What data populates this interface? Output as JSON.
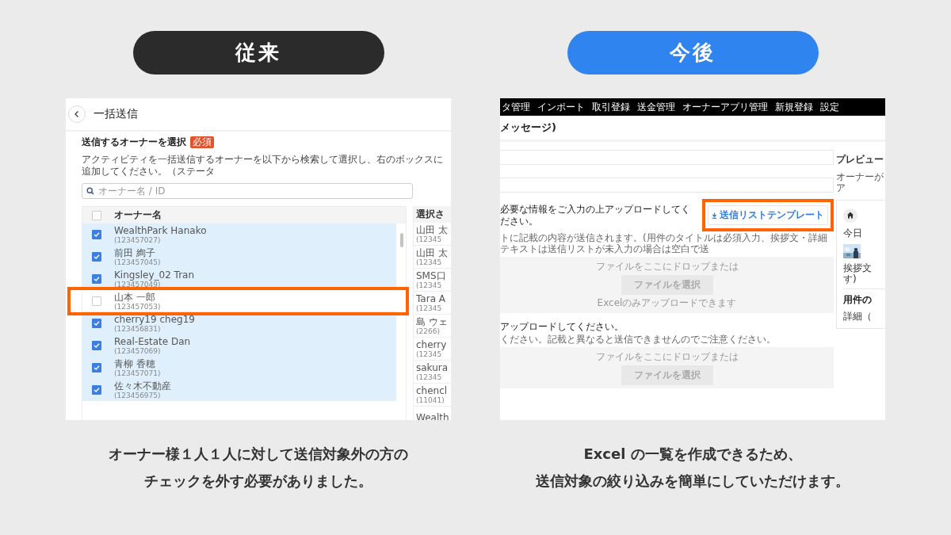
{
  "before": {
    "heading": "従来",
    "screen": {
      "page_title": "一括送信",
      "section_title": "送信するオーナーを選択",
      "required_badge": "必須",
      "description": "アクティビティを一括送信するオーナーを以下から検索して選択し、右のボックスに追加してください。（ステータ",
      "search": {
        "placeholder": "オーナー名 / ID"
      },
      "table": {
        "header_checkbox": {
          "checked": false
        },
        "column": "オーナー名",
        "rows": [
          {
            "name": "WealthPark Hanako",
            "id": "(123457027)",
            "checked": true,
            "highlighted": false
          },
          {
            "name": "前田 絢子",
            "id": "(123457045)",
            "checked": true,
            "highlighted": false
          },
          {
            "name": "Kingsley_02 Tran",
            "id": "(123457049)",
            "checked": true,
            "highlighted": false
          },
          {
            "name": "山本 一郎",
            "id": "(123457053)",
            "checked": false,
            "highlighted": true
          },
          {
            "name": "cherry19 cheg19",
            "id": "(123456831)",
            "checked": true,
            "highlighted": false
          },
          {
            "name": "Real-Estate Dan",
            "id": "(123457069)",
            "checked": true,
            "highlighted": false
          },
          {
            "name": "青柳 香穂",
            "id": "(123457071)",
            "checked": true,
            "highlighted": false
          },
          {
            "name": "佐々木不動産",
            "id": "(123456975)",
            "checked": true,
            "highlighted": false
          }
        ]
      },
      "selected_panel": {
        "header": "選択さ",
        "items": [
          {
            "name": "山田 太",
            "id": "(12345"
          },
          {
            "name": "山田 太",
            "id": "(12345"
          },
          {
            "name": "SMS口",
            "id": "(12345"
          },
          {
            "name": "Tara A",
            "id": "(12345"
          },
          {
            "name": "島 ウェ",
            "id": "(2266)"
          },
          {
            "name": "cherry",
            "id": "(12345"
          },
          {
            "name": "sakura",
            "id": "(12345"
          },
          {
            "name": "chencl",
            "id": "(11041)"
          },
          {
            "name": "Wealth"
          }
        ]
      }
    },
    "caption": [
      "オーナー様１人１人に対して送信対象外の方の",
      "チェックを外す必要がありました。"
    ]
  },
  "after": {
    "heading": "今後",
    "screen": {
      "nav": [
        "タ管理",
        "インポート",
        "取引登録",
        "送金管理",
        "オーナーアプリ管理",
        "新規登録",
        "設定"
      ],
      "page_title": "メッセージ)",
      "upload_sections": [
        {
          "heading": "必要な情報をご入力の上アップロードしてください。",
          "hint": "トに記載の内容が送信されます。(用件のタイトルは必須入力、挨拶文・詳細テキストは送信リストが未入力の場合は空白で送",
          "template_button": {
            "label": "送信リストテンプレート",
            "highlighted": true
          },
          "dropzone": {
            "prompt": "ファイルをここにドロップまたは",
            "button": "ファイルを選択",
            "note": "Excelのみアップロードできます"
          }
        },
        {
          "heading": "アップロードしてください。",
          "hint": "ください。記載と異なると送信できませんのでご注意ください。",
          "dropzone": {
            "prompt": "ファイルをここにドロップまたは",
            "button": "ファイルを選択"
          }
        }
      ],
      "preview": {
        "title": "プレビュー",
        "subtitle": "オーナーがア",
        "date": "今日",
        "lines": [
          "挨拶文",
          "す)"
        ],
        "section_title": "用件の",
        "section_text": "詳細（"
      }
    },
    "caption": [
      "Excel の一覧を作成できるため、",
      "送信対象の絞り込みを簡単にしていただけます。"
    ]
  }
}
